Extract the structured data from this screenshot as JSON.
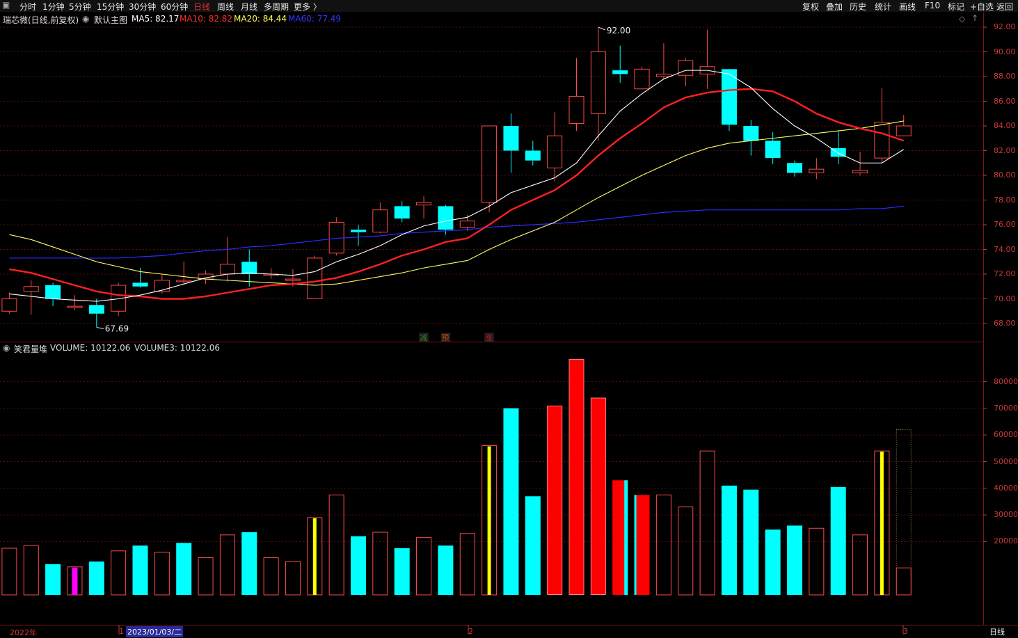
{
  "toolbar": {
    "left_items": [
      "分时",
      "1分钟",
      "5分钟",
      "15分钟",
      "30分钟",
      "60分钟",
      "日线",
      "周线",
      "月线",
      "多周期",
      "更多 〉"
    ],
    "active_item": "日线",
    "right_items": [
      "复权",
      "叠加",
      "历史",
      "统计",
      "画线",
      "F10",
      "标记",
      "+自选",
      "返回"
    ]
  },
  "main_panel": {
    "stock_title": "瑞芯微(日线,前复权)",
    "template": "默认主图",
    "ma5": "MA5: 82.17",
    "ma10": "MA10: 82.82",
    "ma20": "MA20: 84.44",
    "ma60": "MA60: 77.49",
    "high_marker": "92.00",
    "low_marker": "67.69",
    "signals": [
      "减",
      "预",
      "涨"
    ],
    "y_ticks": [
      "92.00",
      "90.00",
      "88.00",
      "86.00",
      "84.00",
      "82.00",
      "80.00",
      "78.00",
      "76.00",
      "74.00",
      "72.00",
      "70.00",
      "68.00"
    ]
  },
  "volume_panel": {
    "title": "笑君量堆",
    "volume_text": "VOLUME: 10122.06",
    "volume3_text": "VOLUME3: 10122.06",
    "y_ticks": [
      "80000",
      "70000",
      "60000",
      "50000",
      "40000",
      "30000",
      "20000"
    ]
  },
  "bottom_bar": {
    "year_label": "2022年",
    "marker_1": "1",
    "date_label": "2023/01/03/二",
    "marker_2": "2",
    "marker_3": "3",
    "period": "日线"
  },
  "colors": {
    "up": "#ff4a4a",
    "down": "#00ffff",
    "ma5": "#ffffff",
    "ma10": "#ff2020",
    "ma20": "#ffff66",
    "ma60": "#2b2bff",
    "yellow_bar": "#ffff00",
    "magenta_bar": "#ff00ff"
  },
  "chart_data": {
    "type": "candlestick",
    "candles": [
      {
        "o": 69.0,
        "h": 70.5,
        "l": 68.8,
        "c": 70.0
      },
      {
        "o": 70.6,
        "h": 71.5,
        "l": 68.7,
        "c": 71.0
      },
      {
        "o": 71.1,
        "h": 71.3,
        "l": 69.4,
        "c": 70.0
      },
      {
        "o": 69.3,
        "h": 70.3,
        "l": 69.1,
        "c": 69.4
      },
      {
        "o": 69.5,
        "h": 70.0,
        "l": 67.7,
        "c": 68.8
      },
      {
        "o": 69.0,
        "h": 71.3,
        "l": 68.6,
        "c": 71.1
      },
      {
        "o": 71.3,
        "h": 72.5,
        "l": 70.9,
        "c": 71.0
      },
      {
        "o": 70.6,
        "h": 72.0,
        "l": 70.4,
        "c": 71.5
      },
      {
        "o": 71.5,
        "h": 73.0,
        "l": 71.2,
        "c": 71.5
      },
      {
        "o": 71.6,
        "h": 72.3,
        "l": 71.2,
        "c": 72.0
      },
      {
        "o": 72.0,
        "h": 75.0,
        "l": 71.4,
        "c": 72.8
      },
      {
        "o": 73.0,
        "h": 74.0,
        "l": 71.0,
        "c": 72.0
      },
      {
        "o": 72.0,
        "h": 72.5,
        "l": 71.6,
        "c": 72.0
      },
      {
        "o": 71.5,
        "h": 72.4,
        "l": 71.0,
        "c": 71.6
      },
      {
        "o": 70.0,
        "h": 73.5,
        "l": 70.0,
        "c": 73.3
      },
      {
        "o": 73.7,
        "h": 76.6,
        "l": 73.5,
        "c": 76.2
      },
      {
        "o": 75.6,
        "h": 76.0,
        "l": 74.3,
        "c": 75.4
      },
      {
        "o": 75.4,
        "h": 77.8,
        "l": 75.3,
        "c": 77.2
      },
      {
        "o": 77.5,
        "h": 77.9,
        "l": 76.2,
        "c": 76.5
      },
      {
        "o": 77.6,
        "h": 78.3,
        "l": 76.5,
        "c": 77.8
      },
      {
        "o": 77.5,
        "h": 77.6,
        "l": 75.2,
        "c": 75.6
      },
      {
        "o": 75.8,
        "h": 76.8,
        "l": 75.5,
        "c": 76.3
      },
      {
        "o": 77.8,
        "h": 84.0,
        "l": 77.0,
        "c": 84.0
      },
      {
        "o": 84.0,
        "h": 85.0,
        "l": 80.2,
        "c": 82.0
      },
      {
        "o": 82.0,
        "h": 82.8,
        "l": 80.8,
        "c": 81.2
      },
      {
        "o": 80.6,
        "h": 85.1,
        "l": 79.5,
        "c": 83.2
      },
      {
        "o": 84.2,
        "h": 89.5,
        "l": 83.6,
        "c": 86.4
      },
      {
        "o": 85.0,
        "h": 92.0,
        "l": 82.8,
        "c": 90.0
      },
      {
        "o": 88.5,
        "h": 90.5,
        "l": 87.5,
        "c": 88.2
      },
      {
        "o": 87.0,
        "h": 88.8,
        "l": 87.0,
        "c": 88.6
      },
      {
        "o": 88.0,
        "h": 90.7,
        "l": 87.8,
        "c": 88.2
      },
      {
        "o": 88.1,
        "h": 89.5,
        "l": 87.2,
        "c": 89.3
      },
      {
        "o": 88.2,
        "h": 91.8,
        "l": 87.0,
        "c": 88.8
      },
      {
        "o": 88.6,
        "h": 88.6,
        "l": 83.6,
        "c": 84.1
      },
      {
        "o": 84.0,
        "h": 84.5,
        "l": 81.6,
        "c": 82.8
      },
      {
        "o": 82.8,
        "h": 83.5,
        "l": 80.9,
        "c": 81.4
      },
      {
        "o": 81.0,
        "h": 81.2,
        "l": 79.9,
        "c": 80.2
      },
      {
        "o": 80.2,
        "h": 81.4,
        "l": 79.7,
        "c": 80.5
      },
      {
        "o": 82.2,
        "h": 83.6,
        "l": 80.9,
        "c": 81.5
      },
      {
        "o": 80.2,
        "h": 81.9,
        "l": 80.0,
        "c": 80.4
      },
      {
        "o": 81.4,
        "h": 87.1,
        "l": 81.0,
        "c": 84.3
      },
      {
        "o": 83.2,
        "h": 84.9,
        "l": 83.2,
        "c": 84.0
      }
    ],
    "ma5": [
      70.4,
      70.2,
      70.0,
      69.9,
      69.8,
      70.0,
      70.3,
      70.7,
      71.2,
      71.7,
      72.0,
      72.1,
      72.0,
      71.9,
      72.2,
      73.0,
      73.6,
      74.3,
      75.2,
      75.9,
      76.3,
      76.6,
      77.5,
      78.6,
      79.2,
      79.8,
      81.0,
      83.2,
      85.2,
      86.6,
      87.8,
      88.5,
      88.5,
      88.2,
      87.1,
      85.4,
      84.0,
      83.0,
      81.8,
      81.0,
      81.0,
      82.1
    ],
    "ma10": [
      72.4,
      72.1,
      71.6,
      71.1,
      70.6,
      70.3,
      70.2,
      70.0,
      70.0,
      70.2,
      70.5,
      70.8,
      71.1,
      71.2,
      71.4,
      71.7,
      72.2,
      72.8,
      73.5,
      74.0,
      74.6,
      74.9,
      76.0,
      77.2,
      78.0,
      78.8,
      80.0,
      81.6,
      83.0,
      84.2,
      85.5,
      86.3,
      86.7,
      86.9,
      87.0,
      86.8,
      86.0,
      85.0,
      84.3,
      83.8,
      83.4,
      82.8
    ],
    "ma20": [
      75.2,
      74.8,
      74.2,
      73.6,
      73.0,
      72.6,
      72.2,
      72.0,
      71.8,
      71.6,
      71.5,
      71.4,
      71.3,
      71.2,
      71.1,
      71.2,
      71.5,
      71.8,
      72.1,
      72.5,
      72.8,
      73.1,
      74.0,
      74.8,
      75.5,
      76.2,
      77.2,
      78.2,
      79.1,
      80.0,
      80.8,
      81.6,
      82.2,
      82.6,
      82.8,
      83.0,
      83.2,
      83.4,
      83.6,
      83.8,
      84.1,
      84.4
    ],
    "ma60": [
      73.3,
      73.3,
      73.3,
      73.3,
      73.3,
      73.3,
      73.4,
      73.5,
      73.7,
      73.9,
      74.0,
      74.2,
      74.3,
      74.5,
      74.7,
      74.9,
      75.0,
      75.1,
      75.3,
      75.4,
      75.5,
      75.6,
      75.8,
      75.9,
      76.0,
      76.1,
      76.2,
      76.4,
      76.6,
      76.8,
      77.0,
      77.1,
      77.2,
      77.2,
      77.2,
      77.2,
      77.2,
      77.2,
      77.2,
      77.3,
      77.3,
      77.5
    ],
    "volumes": [
      {
        "v": 17500,
        "t": "up"
      },
      {
        "v": 18500,
        "t": "up"
      },
      {
        "v": 11500,
        "t": "down"
      },
      {
        "v": 10500,
        "t": "magenta"
      },
      {
        "v": 12500,
        "t": "down"
      },
      {
        "v": 16500,
        "t": "up"
      },
      {
        "v": 18500,
        "t": "down"
      },
      {
        "v": 16000,
        "t": "up"
      },
      {
        "v": 19500,
        "t": "down"
      },
      {
        "v": 14000,
        "t": "up"
      },
      {
        "v": 22500,
        "t": "up"
      },
      {
        "v": 23500,
        "t": "down"
      },
      {
        "v": 14000,
        "t": "up"
      },
      {
        "v": 12500,
        "t": "up"
      },
      {
        "v": 29000,
        "t": "yellow"
      },
      {
        "v": 37500,
        "t": "up"
      },
      {
        "v": 22000,
        "t": "down"
      },
      {
        "v": 23500,
        "t": "up"
      },
      {
        "v": 17500,
        "t": "down"
      },
      {
        "v": 21500,
        "t": "up"
      },
      {
        "v": 18500,
        "t": "down"
      },
      {
        "v": 23000,
        "t": "up"
      },
      {
        "v": 56000,
        "t": "yellow"
      },
      {
        "v": 70000,
        "t": "down"
      },
      {
        "v": 37000,
        "t": "down"
      },
      {
        "v": 71000,
        "t": "redfill"
      },
      {
        "v": 88500,
        "t": "redfill"
      },
      {
        "v": 74000,
        "t": "redfill"
      },
      {
        "v": 43000,
        "t": "cyanred"
      },
      {
        "v": 37500,
        "t": "redcyan"
      },
      {
        "v": 37500,
        "t": "up"
      },
      {
        "v": 33000,
        "t": "up"
      },
      {
        "v": 54000,
        "t": "up"
      },
      {
        "v": 41000,
        "t": "down"
      },
      {
        "v": 39500,
        "t": "down"
      },
      {
        "v": 24500,
        "t": "down"
      },
      {
        "v": 26000,
        "t": "down"
      },
      {
        "v": 25000,
        "t": "up"
      },
      {
        "v": 40500,
        "t": "down"
      },
      {
        "v": 22500,
        "t": "up"
      },
      {
        "v": 54000,
        "t": "yellow"
      },
      {
        "v": 10122.06,
        "t": "up",
        "ghost": 62000
      }
    ]
  }
}
